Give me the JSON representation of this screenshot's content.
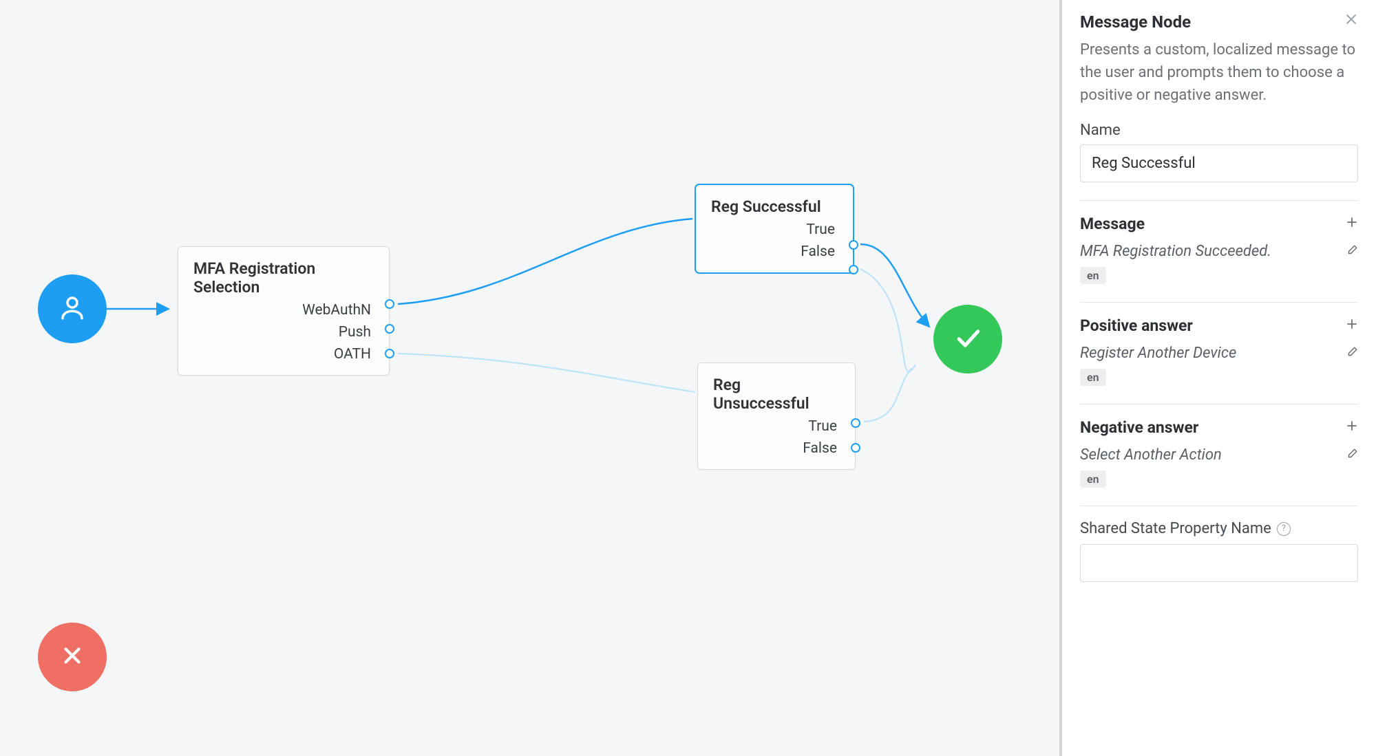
{
  "panel": {
    "title": "Message Node",
    "description": "Presents a custom, localized message to the user and prompts them to choose a positive or negative answer.",
    "name_label": "Name",
    "name_value": "Reg Successful",
    "sections": {
      "message": {
        "title": "Message",
        "value": "MFA Registration Succeeded.",
        "lang": "en"
      },
      "positive": {
        "title": "Positive answer",
        "value": "Register Another Device",
        "lang": "en"
      },
      "negative": {
        "title": "Negative answer",
        "value": "Select Another Action",
        "lang": "en"
      }
    },
    "shared_state_label": "Shared State Property Name",
    "shared_state_value": ""
  },
  "canvas": {
    "nodes": {
      "start": {
        "type": "start"
      },
      "mfa": {
        "title": "MFA Registration Selection",
        "outcomes": [
          "WebAuthN",
          "Push",
          "OATH"
        ]
      },
      "regSuccess": {
        "title": "Reg Successful",
        "outcomes": [
          "True",
          "False"
        ],
        "selected": true
      },
      "regFail": {
        "title": "Reg Unsuccessful",
        "outcomes": [
          "True",
          "False"
        ]
      },
      "success": {
        "type": "success"
      },
      "failure": {
        "type": "failure"
      }
    }
  },
  "icons": {
    "person": "person",
    "check": "check",
    "close": "close",
    "plus": "plus",
    "pencil": "pencil",
    "help": "help"
  }
}
